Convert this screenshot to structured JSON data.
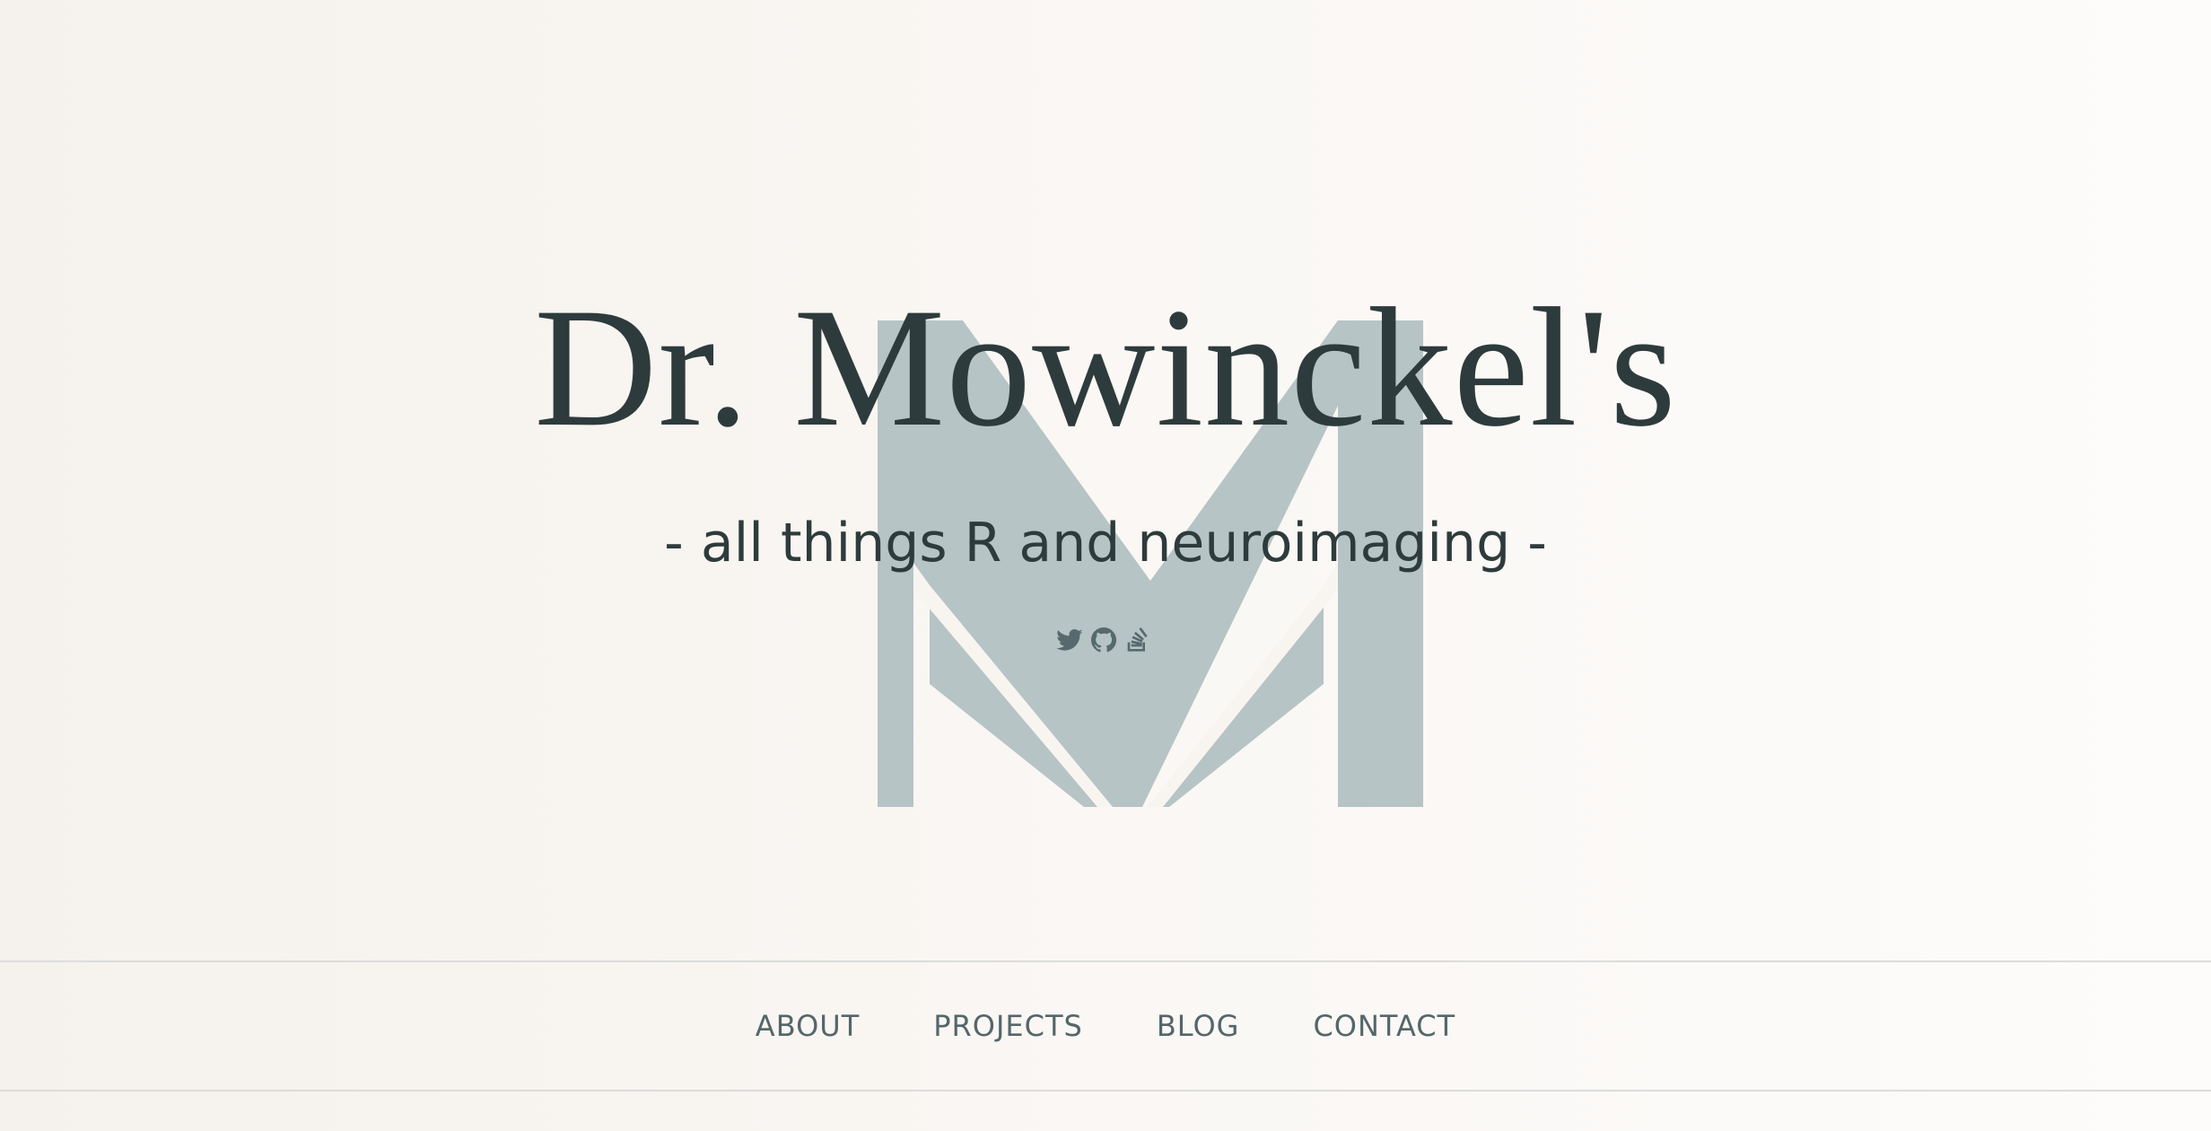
{
  "header": {
    "title": "Dr. Mowinckel's",
    "tagline": "- all things R and neuroimaging -"
  },
  "logo": {
    "icon": "m-letter-logo",
    "color": "#b6c4c5"
  },
  "socials": [
    {
      "icon": "twitter-icon"
    },
    {
      "icon": "github-icon"
    },
    {
      "icon": "stackoverflow-icon"
    }
  ],
  "nav": {
    "items": [
      {
        "label": "ABOUT"
      },
      {
        "label": "PROJECTS"
      },
      {
        "label": "BLOG"
      },
      {
        "label": "CONTACT"
      }
    ]
  },
  "colors": {
    "text": "#2e3b3c",
    "nav_text": "#54666a",
    "icon": "#566a6d",
    "divider": "#dcdcda"
  }
}
